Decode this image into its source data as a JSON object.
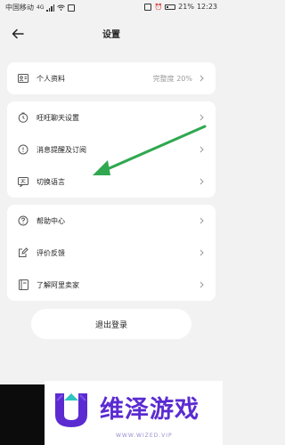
{
  "status_bar": {
    "carrier": "中国移动",
    "network": "4G",
    "battery_percent": "21%",
    "time": "12:23"
  },
  "header": {
    "title": "设置"
  },
  "groups": [
    {
      "items": [
        {
          "label": "个人资料",
          "value": "完整度 20%",
          "icon": "id-card-icon"
        }
      ]
    },
    {
      "items": [
        {
          "label": "旺旺聊天设置",
          "icon": "chat-timer-icon"
        },
        {
          "label": "消息提醒及订阅",
          "icon": "bell-icon"
        },
        {
          "label": "切换语言",
          "icon": "language-icon"
        }
      ]
    },
    {
      "items": [
        {
          "label": "帮助中心",
          "icon": "question-circle-icon"
        },
        {
          "label": "评价反馈",
          "icon": "edit-feedback-icon"
        },
        {
          "label": "了解阿里卖家",
          "icon": "book-icon"
        }
      ]
    }
  ],
  "logout": {
    "label": "退出登录"
  },
  "watermark": {
    "brand_text": "维泽游戏",
    "url_text": "WWW.WIZED.VIP",
    "brand_color": "#5b2bd1"
  },
  "colors": {
    "background": "#f2f2f2",
    "card": "#ffffff",
    "annotation_arrow": "#2fa84f"
  }
}
